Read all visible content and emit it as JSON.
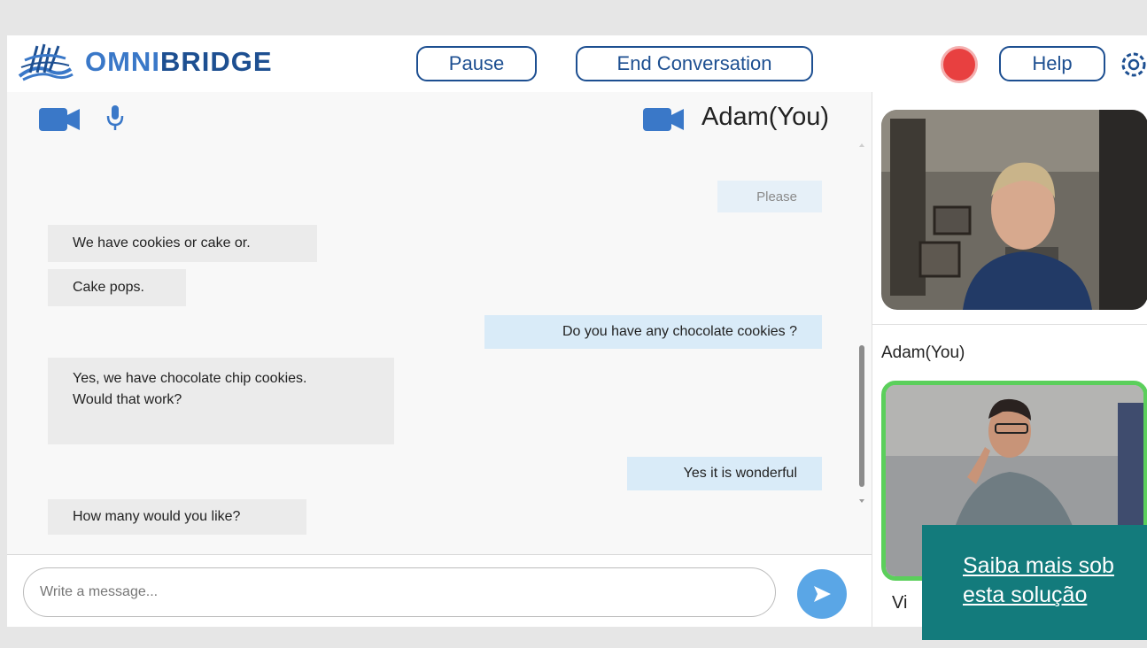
{
  "app": {
    "logo_part1": "OMNI",
    "logo_part2": "BRIDGE",
    "logo_icon": "omnibridge-logo-icon"
  },
  "toolbar": {
    "pause_label": "Pause",
    "end_label": "End Conversation",
    "help_label": "Help",
    "record_color": "#e84040",
    "brand_color": "#1d4f91"
  },
  "chat": {
    "self_name": "Adam(You)",
    "messages": [
      {
        "text": "Please",
        "direction": "out",
        "faded": true
      },
      {
        "text": "We have cookies or cake or.",
        "direction": "in"
      },
      {
        "text": "Cake pops.",
        "direction": "in"
      },
      {
        "text": "Do you have any chocolate cookies ?",
        "direction": "out"
      },
      {
        "line1": "Yes, we have chocolate chip cookies.",
        "line2": "Would that work?",
        "direction": "in"
      },
      {
        "text": "Yes it is wonderful",
        "direction": "out"
      },
      {
        "text": "How many would you like?",
        "direction": "in"
      }
    ],
    "input_placeholder": "Write a message..."
  },
  "sidebar": {
    "tile1_label": "Adam(You)",
    "tile2_label_partial": "Vi",
    "active_color": "#5bcf5b"
  },
  "banner": {
    "line1": "Saiba mais sob",
    "line2": "esta solução",
    "color": "#137b7c"
  }
}
